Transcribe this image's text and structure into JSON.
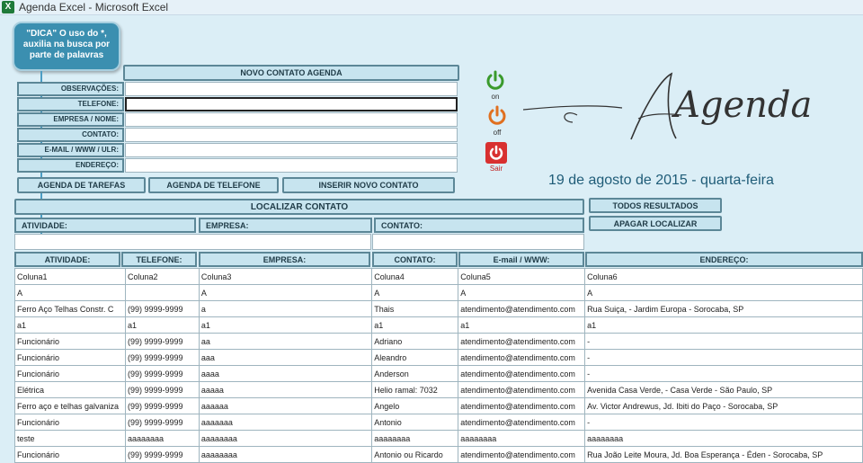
{
  "window": {
    "title": "Agenda Excel - Microsoft Excel",
    "app_icon": "excel-icon"
  },
  "tip": {
    "text": "\"DICA\" O uso do *, auxilia na busca por parte de palavras"
  },
  "form": {
    "title": "NOVO CONTATO AGENDA",
    "fields": [
      {
        "label": "OBSERVAÇÕES:",
        "value": ""
      },
      {
        "label": "TELEFONE:",
        "value": ""
      },
      {
        "label": "EMPRESA / NOME:",
        "value": ""
      },
      {
        "label": "CONTATO:",
        "value": ""
      },
      {
        "label": "E-MAIL / WWW / ULR:",
        "value": ""
      },
      {
        "label": "ENDEREÇO:",
        "value": ""
      }
    ],
    "buttons": {
      "tasks": "AGENDA DE TAREFAS",
      "phone": "AGENDA DE TELEFONE",
      "insert": "INSERIR NOVO CONTATO"
    }
  },
  "controls": {
    "on": "on",
    "off": "off",
    "exit": "Sair",
    "on_color": "#3a9a2c",
    "off_color": "#e07020",
    "exit_color": "#d83030"
  },
  "logo": {
    "text": "Agenda"
  },
  "date": "19 de agosto de 2015 - quarta-feira",
  "search": {
    "title": "LOCALIZAR CONTATO",
    "all_results": "TODOS RESULTADOS",
    "clear": "APAGAR LOCALIZAR",
    "fields": [
      {
        "label": "ATIVIDADE:",
        "value": ""
      },
      {
        "label": "EMPRESA:",
        "value": ""
      },
      {
        "label": "CONTATO:",
        "value": ""
      }
    ]
  },
  "table": {
    "headers": [
      "ATIVIDADE:",
      "TELEFONE:",
      "EMPRESA:",
      "CONTATO:",
      "E-mail / WWW:",
      "ENDEREÇO:"
    ],
    "rows": [
      [
        "Coluna1",
        "Coluna2",
        "Coluna3",
        "Coluna4",
        "Coluna5",
        "Coluna6"
      ],
      [
        "A",
        "",
        "A",
        "A",
        "A",
        "A"
      ],
      [
        "Ferro Aço Telhas Constr. C",
        "(99) 9999-9999",
        "a",
        "Thais",
        "atendimento@atendimento.com",
        "Rua Suiça,  - Jardim Europa - Sorocaba, SP"
      ],
      [
        "a1",
        "a1",
        "a1",
        "a1",
        "a1",
        "a1"
      ],
      [
        "Funcionário",
        "(99) 9999-9999",
        "aa",
        "Adriano",
        "atendimento@atendimento.com",
        "-"
      ],
      [
        "Funcionário",
        "(99) 9999-9999",
        "aaa",
        "Aleandro",
        "atendimento@atendimento.com",
        "-"
      ],
      [
        "Funcionário",
        "(99) 9999-9999",
        "aaaa",
        "Anderson",
        "atendimento@atendimento.com",
        "-"
      ],
      [
        "Elétrica",
        "(99) 9999-9999",
        "aaaaa",
        "Helio ramal: 7032",
        "atendimento@atendimento.com",
        "Avenida Casa Verde,  - Casa Verde - São Paulo, SP"
      ],
      [
        "Ferro aço e telhas galvaniza",
        "(99) 9999-9999",
        "aaaaaa",
        "Angelo",
        "atendimento@atendimento.com",
        "Av. Victor Andrewus,  Jd. Ibiti do Paço - Sorocaba, SP"
      ],
      [
        "Funcionário",
        "(99) 9999-9999",
        "aaaaaaa",
        "Antonio",
        "atendimento@atendimento.com",
        "-"
      ],
      [
        "teste",
        "aaaaaaaa",
        "aaaaaaaa",
        "aaaaaaaa",
        "aaaaaaaa",
        "aaaaaaaa"
      ],
      [
        "Funcionário",
        "(99) 9999-9999",
        "aaaaaaaa",
        "Antonio ou Ricardo",
        "atendimento@atendimento.com",
        "Rua João Leite Moura,  Jd. Boa Esperança - Éden - Sorocaba, SP"
      ]
    ]
  }
}
